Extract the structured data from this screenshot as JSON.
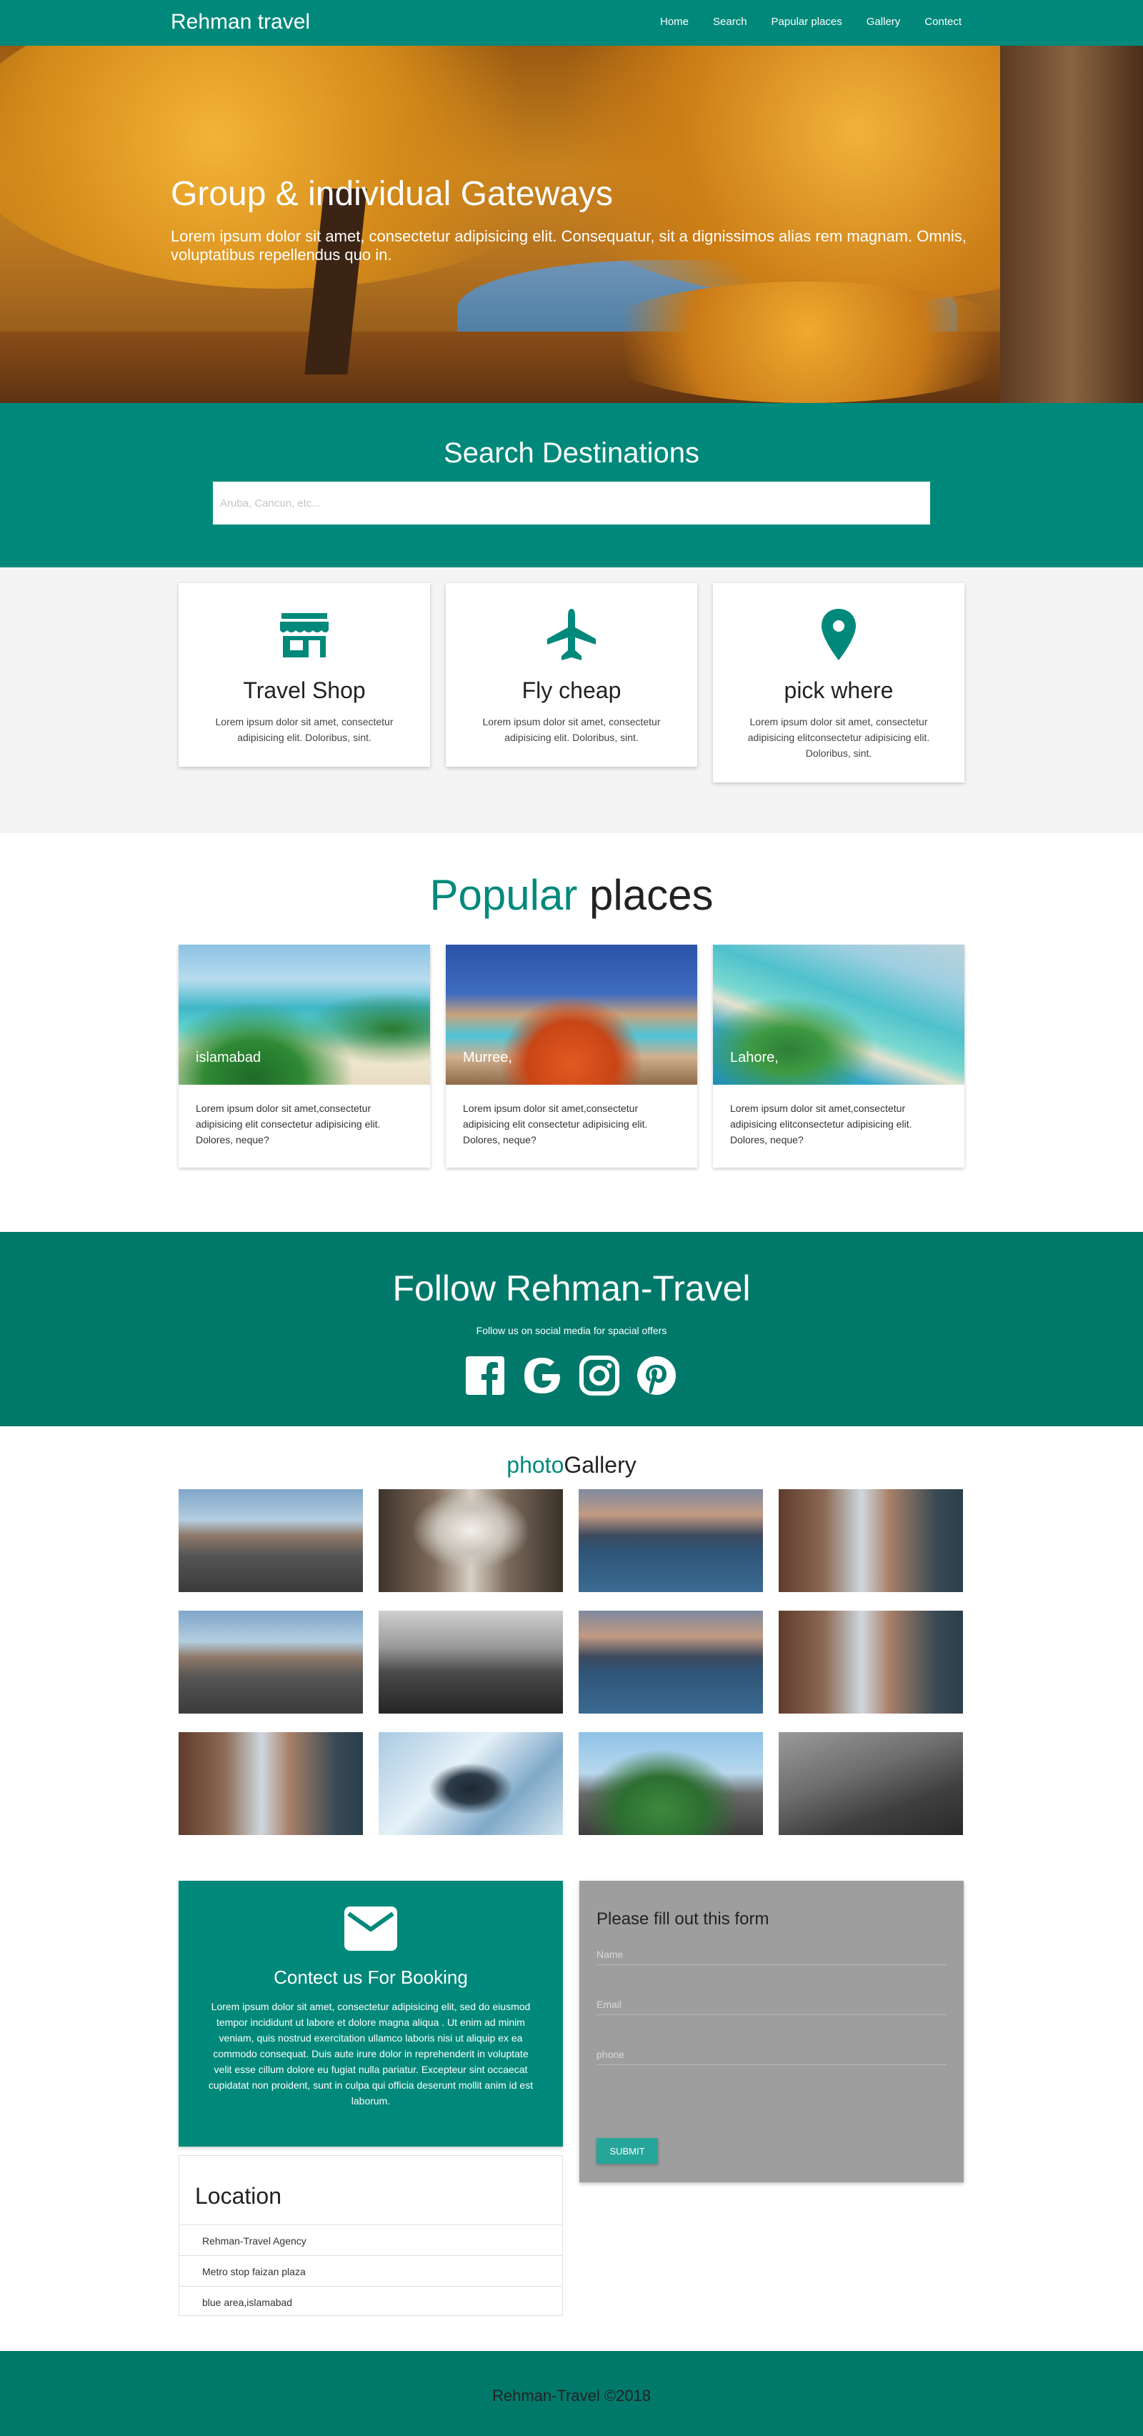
{
  "nav": {
    "brand": "Rehman travel",
    "links": [
      "Home",
      "Search",
      "Papular places",
      "Gallery",
      "Contect"
    ]
  },
  "hero": {
    "title": "Group & individual Gateways",
    "subtitle": "Lorem ipsum dolor sit amet, consectetur adipisicing elit. Consequatur, sit a dignissimos alias rem magnam. Omnis, voluptatibus repellendus quo in."
  },
  "search": {
    "title": "Search Destinations",
    "placeholder": "Aruba, Cancun, etc..."
  },
  "features": [
    {
      "icon": "store-icon",
      "title": "Travel Shop",
      "text": "Lorem ipsum dolor sit amet, consectetur adipisicing elit. Doloribus, sint."
    },
    {
      "icon": "airplane-icon",
      "title": "Fly cheap",
      "text": "Lorem ipsum dolor sit amet, consectetur adipisicing elit. Doloribus, sint."
    },
    {
      "icon": "location-pin-icon",
      "title": "pick where",
      "text": "Lorem ipsum dolor sit amet, consectetur adipisicing elitconsectetur adipisicing elit. Doloribus, sint."
    }
  ],
  "popular": {
    "title_accent": "Popular",
    "title_rest": " places",
    "places": [
      {
        "name": "islamabad",
        "text": "Lorem ipsum dolor sit amet,consectetur adipisicing elit consectetur adipisicing elit. Dolores, neque?"
      },
      {
        "name": "Murree,",
        "text": "Lorem ipsum dolor sit amet,consectetur adipisicing elit consectetur adipisicing elit. Dolores, neque?"
      },
      {
        "name": "Lahore,",
        "text": "Lorem ipsum dolor sit amet,consectetur adipisicing elitconsectetur adipisicing elit. Dolores, neque?"
      }
    ]
  },
  "follow": {
    "title": "Follow Rehman-Travel",
    "subtitle": "Follow us on social media for spacial offers",
    "icons": [
      "facebook-icon",
      "google-icon",
      "instagram-icon",
      "pinterest-icon"
    ]
  },
  "gallery": {
    "title_accent": "photo",
    "title_rest": "Gallery"
  },
  "contact": {
    "title": "Contect us For Booking",
    "text": "Lorem ipsum dolor sit amet, consectetur adipisicing elit, sed do eiusmod tempor incididunt ut labore et dolore magna aliqua . Ut enim ad minim veniam, quis nostrud exercitation ullamco laboris nisi ut aliquip ex ea commodo consequat. Duis aute irure dolor in reprehenderit in voluptate velit esse cillum dolore eu fugiat nulla pariatur. Excepteur sint occaecat cupidatat non proident, sunt in culpa qui officia deserunt mollit anim id est laborum."
  },
  "form": {
    "title": "Please fill out this form",
    "name_placeholder": "Name",
    "email_placeholder": "Email",
    "phone_placeholder": "phone",
    "submit_label": "SUBMIT"
  },
  "location": {
    "title": "Location",
    "items": [
      "Rehman-Travel Agency",
      "Metro stop faizan plaza",
      "blue area,islamabad"
    ]
  },
  "footer": {
    "text": "Rehman-Travel ©2018"
  },
  "colors": {
    "primary": "#00897b",
    "primary_dark": "#00796b",
    "form_bg": "#9e9e9e",
    "button": "#26a69a"
  }
}
